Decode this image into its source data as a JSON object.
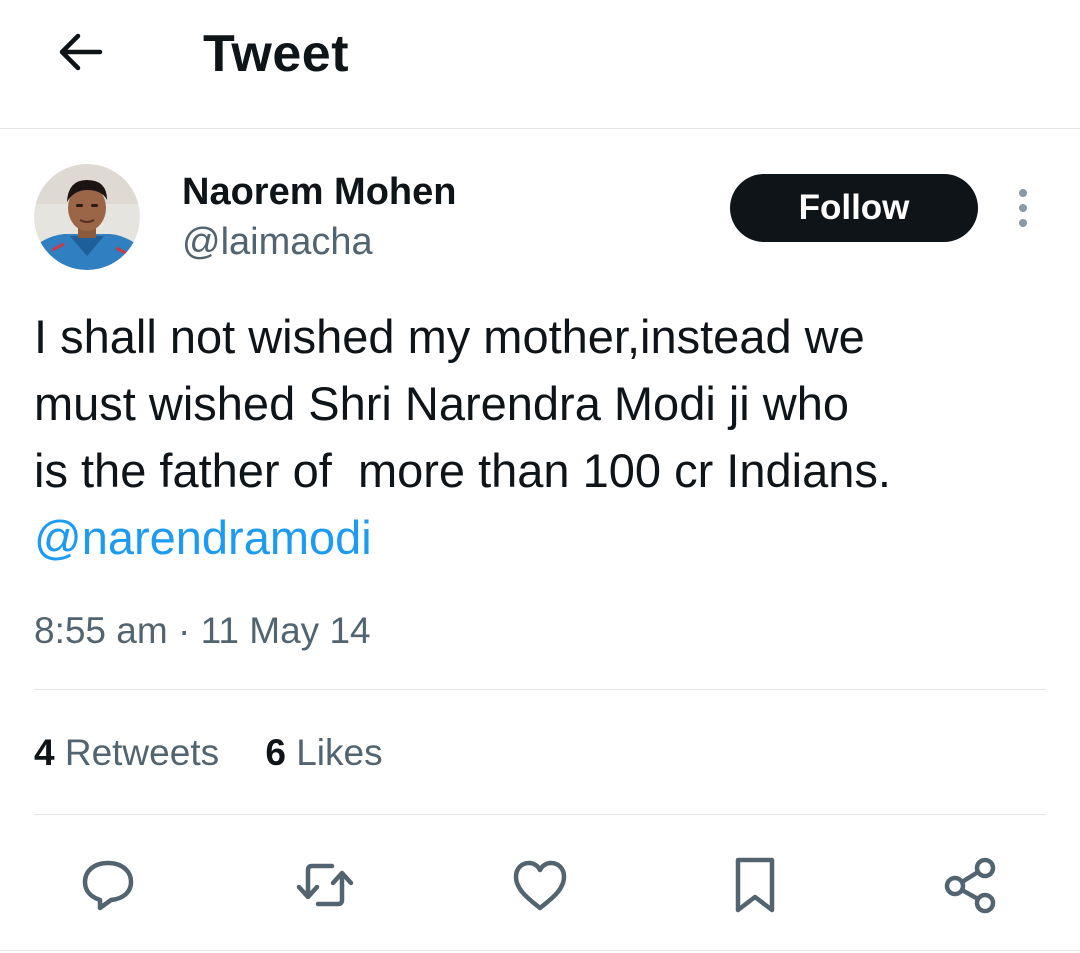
{
  "header": {
    "back_icon": "arrow-left-icon",
    "title": "Tweet"
  },
  "author": {
    "name": "Naorem Mohen",
    "handle": "@laimacha",
    "avatar_icon": "profile-photo"
  },
  "follow_button": {
    "label": "Follow"
  },
  "more_icon": "vertical-ellipsis-icon",
  "tweet": {
    "lines": [
      "I shall not wished my mother,instead we",
      "must wished Shri Narendra Modi ji who",
      "is the father of  more than 100 cr Indians."
    ],
    "mention": "@narendramodi",
    "timestamp": "8:55 am · 11 May 14"
  },
  "stats": {
    "retweets_count": "4",
    "retweets_label": "Retweets",
    "likes_count": "6",
    "likes_label": "Likes"
  },
  "actions": [
    {
      "name": "reply",
      "icon": "speech-bubble-icon"
    },
    {
      "name": "retweet",
      "icon": "retweet-arrows-icon"
    },
    {
      "name": "like",
      "icon": "heart-icon"
    },
    {
      "name": "bookmark",
      "icon": "bookmark-icon"
    },
    {
      "name": "share",
      "icon": "share-nodes-icon"
    }
  ],
  "colors": {
    "text_primary": "#0f1419",
    "text_secondary": "#536471",
    "link": "#1d9bf0",
    "follow_bg": "#0f1419",
    "follow_text": "#ffffff",
    "divider": "#e3e6e8"
  }
}
